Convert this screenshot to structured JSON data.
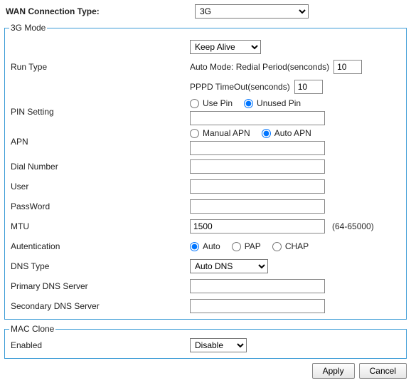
{
  "header": {
    "wan_label": "WAN Connection Type:",
    "wan_value": "3G"
  },
  "mode3g": {
    "legend": "3G Mode",
    "run_type_label": "Run Type",
    "run_type_value": "Keep Alive",
    "redial_label": "Auto Mode: Redial Period(senconds)",
    "redial_value": "10",
    "pppd_label": "PPPD TimeOut(senconds)",
    "pppd_value": "10",
    "pin_label": "PIN Setting",
    "pin_use": "Use Pin",
    "pin_unused": "Unused Pin",
    "pin_selected": "unused",
    "pin_value": "",
    "apn_label": "APN",
    "apn_manual": "Manual APN",
    "apn_auto": "Auto APN",
    "apn_selected": "auto",
    "apn_value": "",
    "dial_label": "Dial Number",
    "dial_value": "",
    "user_label": "User",
    "user_value": "",
    "pass_label": "PassWord",
    "pass_value": "",
    "mtu_label": "MTU",
    "mtu_value": "1500",
    "mtu_note": "(64-65000)",
    "auth_label": "Autentication",
    "auth_auto": "Auto",
    "auth_pap": "PAP",
    "auth_chap": "CHAP",
    "auth_selected": "auto",
    "dns_type_label": "DNS Type",
    "dns_type_value": "Auto DNS",
    "pdns_label": "Primary DNS Server",
    "pdns_value": "",
    "sdns_label": "Secondary DNS Server",
    "sdns_value": ""
  },
  "mac": {
    "legend": "MAC Clone",
    "enabled_label": "Enabled",
    "enabled_value": "Disable"
  },
  "buttons": {
    "apply": "Apply",
    "cancel": "Cancel"
  }
}
